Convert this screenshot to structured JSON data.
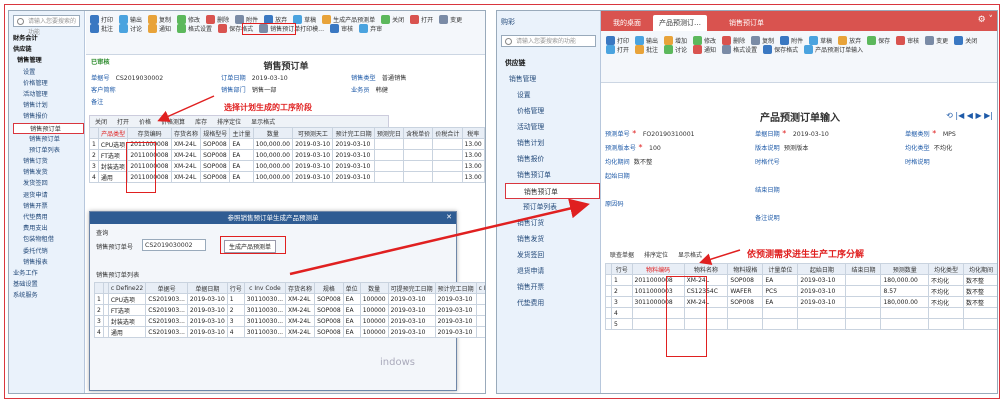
{
  "left": {
    "search_placeholder": "请输入您要搜索的功能",
    "nav": [
      "财务会计",
      "供应链",
      "销售管理",
      "设置",
      "价格管理",
      "活动管理",
      "销售计划",
      "销售报价",
      "销售预订单",
      "销售预订单",
      "预订单列表",
      "销售订货",
      "销售发货",
      "发货签回",
      "退货申请",
      "销售开票",
      "代垫费用",
      "费用支出",
      "包装物租借",
      "委托代销",
      "销售报表",
      "业务工作",
      "基础设置",
      "系统服务"
    ],
    "ribbon": [
      "打印",
      "输出",
      "复制",
      "修改",
      "删除",
      "附件",
      "放弃",
      "草稿",
      "生成产品预测单",
      "关闭",
      "打开",
      "变更",
      "批注",
      "讨论",
      "通知",
      "格式设置",
      "保存格式",
      "销售预订单打印模…",
      "审核",
      "弃审"
    ],
    "status": "已审核",
    "title": "销售预订单",
    "header": [
      {
        "label": "单据号",
        "value": "CS2019030002"
      },
      {
        "label": "订单日期",
        "value": "2019-03-10"
      },
      {
        "label": "销售类型",
        "value": "普通销售"
      },
      {
        "label": "客户简称",
        "value": ""
      },
      {
        "label": "销售部门",
        "value": "销售一部"
      },
      {
        "label": "业务员",
        "value": "韩健"
      },
      {
        "label": "备注",
        "value": ""
      }
    ],
    "tabs": [
      "关闭",
      "打开",
      "价格",
      "价格测算",
      "库存",
      "排序定位",
      "显示格式"
    ],
    "cols": [
      "",
      "产品类型",
      "存货编码",
      "存货名称",
      "规格型号",
      "主计量",
      "数量",
      "可预测天工",
      "预计完工日期",
      "预测完日",
      "含税单价",
      "价税合计",
      "税率"
    ],
    "rows": [
      [
        "1",
        "CPU选项",
        "2011000008",
        "XM-24L",
        "SOP008",
        "EA",
        "100,000.00",
        "2019-03-10",
        "2019-03-10",
        "",
        "",
        "",
        "13.00"
      ],
      [
        "2",
        "FT选项",
        "2011000008",
        "XM-24L",
        "SOP008",
        "EA",
        "100,000.00",
        "2019-03-10",
        "2019-03-10",
        "",
        "",
        "",
        "13.00"
      ],
      [
        "3",
        "封装选项",
        "2011000008",
        "XM-24L",
        "SOP008",
        "EA",
        "100,000.00",
        "2019-03-10",
        "2019-03-10",
        "",
        "",
        "",
        "13.00"
      ],
      [
        "4",
        "通用",
        "2011000008",
        "XM-24L",
        "SOP008",
        "EA",
        "100,000.00",
        "2019-03-10",
        "2019-03-10",
        "",
        "",
        "",
        "13.00"
      ]
    ],
    "annotation": "选择计划生成的工序阶段",
    "dialog": {
      "title": "参照销售预订单生成产品预测单",
      "sub": "查询",
      "field_label": "销售预订单号",
      "field_value": "CS2019030002",
      "button": "生成产品预测单",
      "list_title": "销售预订单列表",
      "cols": [
        "",
        "",
        "c Define22",
        "单据号",
        "单据日期",
        "行号",
        "c Inv Code",
        "存货名称",
        "规格",
        "单位",
        "数量",
        "可提预完工日期",
        "预计完工日期",
        "c Free1"
      ],
      "rows": [
        [
          "1",
          "",
          "CPU选项",
          "CS201903...",
          "2019-03-10",
          "1",
          "30110030...",
          "XM-24L",
          "SOP008",
          "EA",
          "100000",
          "2019-03-10",
          "2019-03-10",
          ""
        ],
        [
          "2",
          "",
          "FT选项",
          "CS201903...",
          "2019-03-10",
          "2",
          "30110030...",
          "XM-24L",
          "SOP008",
          "EA",
          "100000",
          "2019-03-10",
          "2019-03-10",
          ""
        ],
        [
          "3",
          "",
          "封装选项",
          "CS201903...",
          "2019-03-10",
          "3",
          "30110030...",
          "XM-24L",
          "SOP008",
          "EA",
          "100000",
          "2019-03-10",
          "2019-03-10",
          ""
        ],
        [
          "4",
          "",
          "通用",
          "CS201903...",
          "2019-03-10",
          "4",
          "30110030...",
          "XM-24L",
          "SOP008",
          "EA",
          "100000",
          "2019-03-10",
          "2019-03-10",
          ""
        ]
      ],
      "watermark": "indows"
    }
  },
  "right": {
    "sidebar_title": "购彩",
    "search_placeholder": "请输入您要搜索的功能",
    "nav": [
      "供应链",
      "销售管理",
      "设置",
      "价格管理",
      "活动管理",
      "销售计划",
      "销售报价",
      "销售预订单",
      "销售预订单",
      "预订单列表",
      "销售订货",
      "销售发货",
      "发货签回",
      "退货申请",
      "销售开票",
      "代垫费用"
    ],
    "tabs": [
      "我的桌面",
      "产品预测订…",
      "销售预订单"
    ],
    "ribbon": [
      "打印",
      "输出",
      "增加",
      "修改",
      "删除",
      "复制",
      "附件",
      "草稿",
      "放弃",
      "保存",
      "审核",
      "变更",
      "关闭",
      "打开",
      "批注",
      "讨论",
      "通知",
      "格式设置",
      "保存格式",
      "产品预测订单输入"
    ],
    "title": "产品预测订单输入",
    "header": [
      {
        "label": "预测单号",
        "value": "FO20190310001",
        "req": true
      },
      {
        "label": "单据日期",
        "value": "2019-03-10",
        "req": true
      },
      {
        "label": "单据类别",
        "value": "MPS",
        "req": true
      },
      {
        "label": "预测版本号",
        "value": "100",
        "req": true
      },
      {
        "label": "版本说明",
        "value": "预测版本"
      },
      {
        "label": "均化类型",
        "value": "不均化"
      },
      {
        "label": "均化期间",
        "value": "数不整"
      },
      {
        "label": "时格代号",
        "value": ""
      },
      {
        "label": "时格说明",
        "value": ""
      },
      {
        "label": "起始日期",
        "value": ""
      },
      {
        "label": "结束日期",
        "value": ""
      },
      {
        "label": "原因码",
        "value": ""
      },
      {
        "label": "备注说明",
        "value": ""
      }
    ],
    "gridtabs": [
      "联查单据",
      "排序定位",
      "显示格式"
    ],
    "cols": [
      "",
      "行号",
      "物料编码",
      "物料名称",
      "物料规格",
      "计量单位",
      "起始日期",
      "结束日期",
      "预测数量",
      "均化类型",
      "均化期间"
    ],
    "rows": [
      [
        "",
        "1",
        "2011000008",
        "XM-24L",
        "SOP008",
        "EA",
        "2019-03-10",
        "",
        "180,000.00",
        "不均化",
        "数不整"
      ],
      [
        "",
        "2",
        "1011000003",
        "CS12354C",
        "WAFER",
        "PCS",
        "2019-03-10",
        "",
        "8.57",
        "不均化",
        "数不整"
      ],
      [
        "",
        "3",
        "3011000008",
        "XM-24L",
        "SOP008",
        "EA",
        "2019-03-10",
        "",
        "180,000.00",
        "不均化",
        "数不整"
      ],
      [
        "",
        "4",
        "",
        "",
        "",
        "",
        "",
        "",
        "",
        "",
        ""
      ],
      [
        "",
        "5",
        "",
        "",
        "",
        "",
        "",
        "",
        "",
        "",
        ""
      ]
    ],
    "annotation": "依预测需求进生生产工序分解"
  }
}
